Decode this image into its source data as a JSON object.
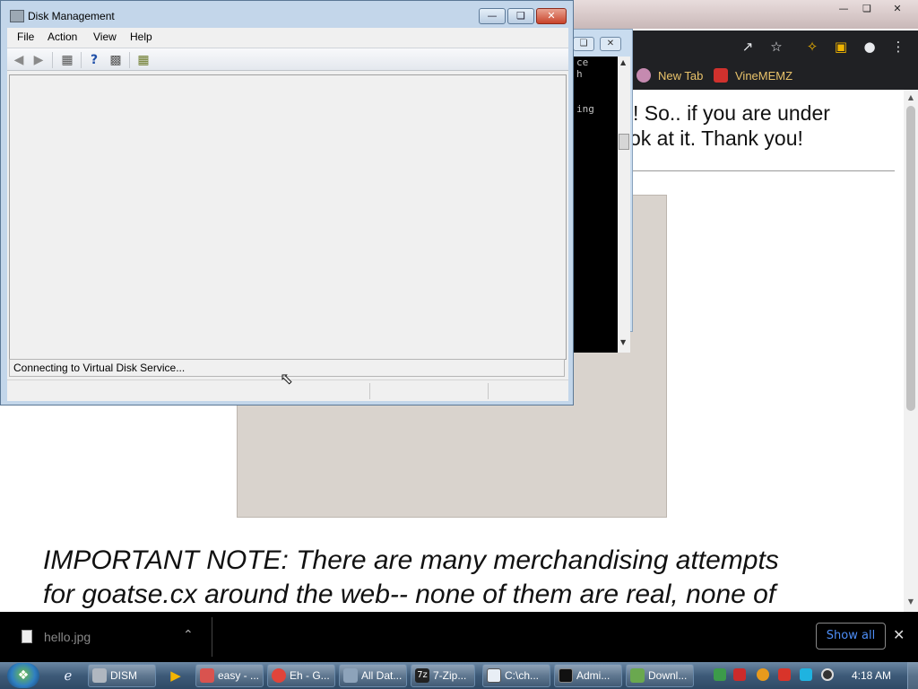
{
  "browser": {
    "bookmarks": [
      {
        "label": "New Tab"
      },
      {
        "label": "VineMEMZ"
      }
    ],
    "page": {
      "fragment_lines": [
        "! So.. if you are under",
        "ok at it. Thank you!"
      ],
      "image_placeholder": "[image omitted]",
      "note_lines": [
        "IMPORTANT NOTE: There are many merchandising attempts",
        "for goatse.cx around the web-- none of them are real, none of"
      ]
    },
    "downloads": {
      "file_name": "hello.jpg",
      "show_all": "Show all"
    }
  },
  "console": {
    "lines": [
      "ce",
      "h",
      "",
      "",
      "ing"
    ]
  },
  "disk_management": {
    "title": "Disk Management",
    "menu": [
      "File",
      "Action",
      "View",
      "Help"
    ],
    "status": "Connecting to Virtual Disk Service..."
  },
  "taskbar": {
    "tasks": [
      {
        "label": "DISM"
      },
      {
        "label": "easy - ..."
      },
      {
        "label": "Eh - G..."
      },
      {
        "label": "All Dat..."
      },
      {
        "label": "7-Zip..."
      },
      {
        "label": "C:\\ch..."
      },
      {
        "label": "Admi..."
      },
      {
        "label": "Downl..."
      }
    ],
    "clock": "4:18 AM"
  }
}
